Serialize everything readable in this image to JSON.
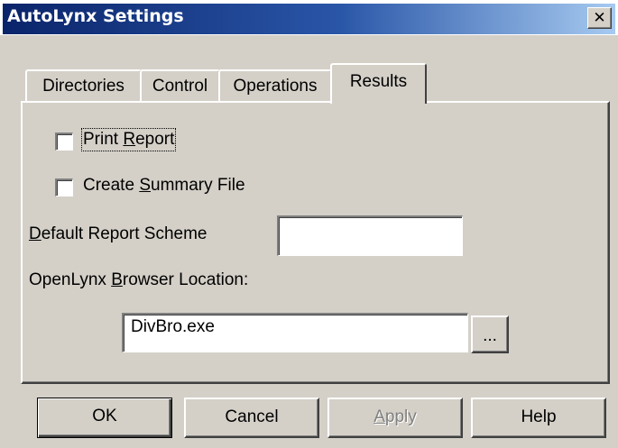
{
  "window": {
    "title": "AutoLynx Settings",
    "close_glyph": "✕"
  },
  "tabs": [
    {
      "pre": "Directories",
      "ul": "",
      "post": "",
      "active": false
    },
    {
      "pre": "Control",
      "ul": "",
      "post": "",
      "active": false
    },
    {
      "pre": "Operations",
      "ul": "",
      "post": "",
      "active": false
    },
    {
      "pre": "Results",
      "ul": "",
      "post": "",
      "active": true
    }
  ],
  "results": {
    "print_report": {
      "pre": "Print ",
      "ul": "R",
      "post": "eport",
      "checked": false
    },
    "create_summary": {
      "pre": "Create ",
      "ul": "S",
      "post": "ummary File",
      "checked": false
    },
    "default_scheme": {
      "ul": "D",
      "post": "efault Report Scheme",
      "value": ""
    },
    "browser_location": {
      "pre": "OpenLynx ",
      "ul": "B",
      "post": "rowser Location:",
      "value": "DivBro.exe",
      "browse_label": "..."
    }
  },
  "buttons": {
    "ok": "OK",
    "cancel": "Cancel",
    "apply_ul": "A",
    "apply_post": "pply",
    "help": "Help"
  }
}
